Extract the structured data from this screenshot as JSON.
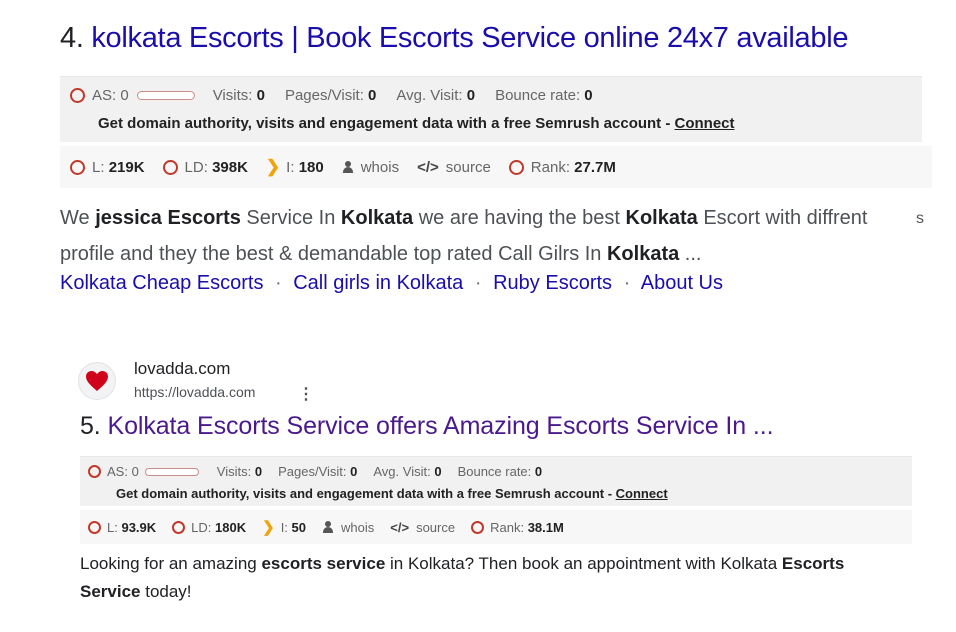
{
  "result4": {
    "number": "4.",
    "title": "kolkata Escorts | Book Escorts Service online 24x7 available",
    "semrush": {
      "as_label": "AS: 0",
      "visits_label": "Visits:",
      "visits_value": "0",
      "pages_label": "Pages/Visit:",
      "pages_value": "0",
      "avg_label": "Avg. Visit:",
      "avg_value": "0",
      "bounce_label": "Bounce rate:",
      "bounce_value": "0",
      "cta": "Get domain authority, visits and engagement data with a free Semrush account -",
      "connect": "Connect"
    },
    "metrics": {
      "l_label": "L:",
      "l_value": "219K",
      "ld_label": "LD:",
      "ld_value": "398K",
      "i_label": "I:",
      "i_value": "180",
      "whois": "whois",
      "source": "source",
      "rank_label": "Rank:",
      "rank_value": "27.7M"
    },
    "snippet": {
      "t1": "We ",
      "b1": "jessica Escorts",
      "t2": " Service In ",
      "b2": "Kolkata",
      "t3": " we are having the best ",
      "b3": "Kolkata",
      "t4": " Escort with diffrent profile and they the best & demandable top rated Call Gilrs In ",
      "b4": "Kolkata",
      "t5": " ..."
    },
    "trail_char": "s",
    "sitelinks": [
      "Kolkata Cheap Escorts",
      "Call girls in Kolkata",
      "Ruby Escorts",
      "About Us"
    ],
    "sitelink_sep": "·"
  },
  "result5": {
    "site_name": "lovadda.com",
    "url": "https://lovadda.com",
    "number": "5.",
    "title": "Kolkata Escorts Service offers Amazing Escorts Service In ...",
    "semrush": {
      "as_label": "AS: 0",
      "visits_label": "Visits:",
      "visits_value": "0",
      "pages_label": "Pages/Visit:",
      "pages_value": "0",
      "avg_label": "Avg. Visit:",
      "avg_value": "0",
      "bounce_label": "Bounce rate:",
      "bounce_value": "0",
      "cta": "Get domain authority, visits and engagement data with a free Semrush account -",
      "connect": "Connect"
    },
    "metrics": {
      "l_label": "L:",
      "l_value": "93.9K",
      "ld_label": "LD:",
      "ld_value": "180K",
      "i_label": "I:",
      "i_value": "50",
      "whois": "whois",
      "source": "source",
      "rank_label": "Rank:",
      "rank_value": "38.1M"
    },
    "snippet": {
      "t1": "Looking for an amazing ",
      "b1": "escorts service",
      "t2": " in Kolkata? Then book an appointment with Kolkata ",
      "b2": "Escorts Service",
      "t3": " today!"
    }
  },
  "icons": {
    "ring": "semrush-ring-icon",
    "bing": "bing-icon",
    "whois": "person-icon",
    "source": "code-icon",
    "favicon": "heart-icon",
    "menu": "more-vert-icon"
  },
  "colors": {
    "title_link": "#1a0dab",
    "visited_link": "#4a1a8c",
    "ring": "#c0392b",
    "bing": "#f0a30a",
    "semrush_bg": "#f1f1f1",
    "heart": "#d0021b"
  }
}
